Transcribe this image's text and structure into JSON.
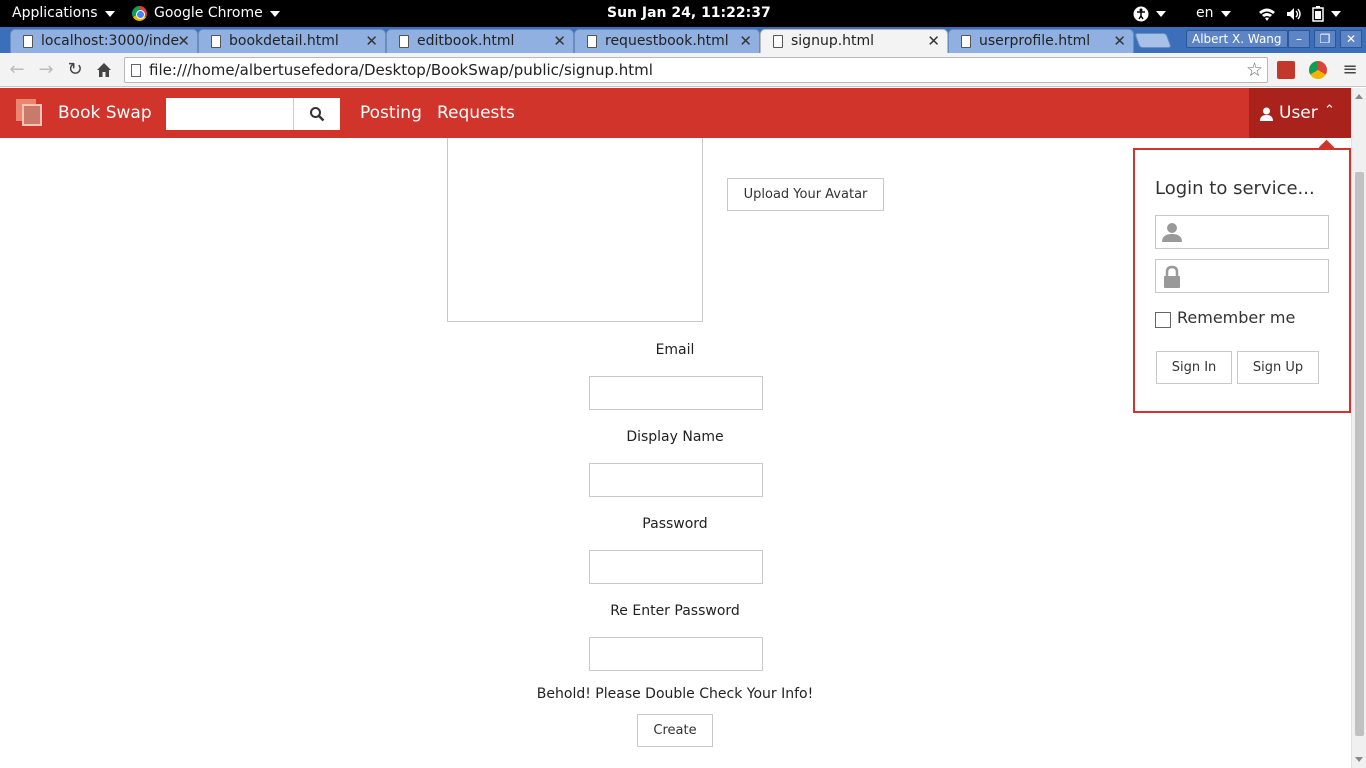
{
  "system_bar": {
    "applications": "Applications",
    "browser_app": "Google Chrome",
    "clock": "Sun Jan 24, 11:22:37",
    "language": "en"
  },
  "tabs": [
    {
      "title": "localhost:3000/inde",
      "active": false
    },
    {
      "title": "bookdetail.html",
      "active": false
    },
    {
      "title": "editbook.html",
      "active": false
    },
    {
      "title": "requestbook.html",
      "active": false
    },
    {
      "title": "signup.html",
      "active": true
    },
    {
      "title": "userprofile.html",
      "active": false
    }
  ],
  "profile_name": "Albert X. Wang",
  "address_bar": {
    "url": "file:///home/albertusefedora/Desktop/BookSwap/public/signup.html"
  },
  "navbar": {
    "brand": "Book Swap",
    "search_placeholder": "",
    "links": [
      "Posting",
      "Requests"
    ],
    "user_menu": "User"
  },
  "signup_form": {
    "upload_avatar": "Upload Your Avatar",
    "email_label": "Email",
    "display_name_label": "Display Name",
    "password_label": "Password",
    "reenter_password_label": "Re Enter Password",
    "notice": "Behold! Please Double Check Your Info!",
    "create_button": "Create"
  },
  "login_panel": {
    "title": "Login to service...",
    "username_placeholder": "",
    "password_placeholder": "",
    "remember_me": "Remember me",
    "remember_checked": false,
    "sign_in": "Sign In",
    "sign_up": "Sign Up"
  },
  "colors": {
    "brand_red": "#d1342a",
    "user_menu_red": "#a9221b"
  }
}
